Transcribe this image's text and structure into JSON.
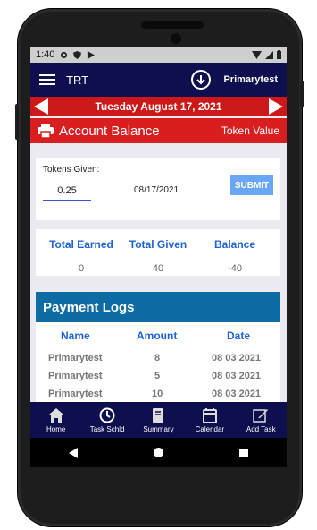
{
  "status": {
    "time": "1:40"
  },
  "appbar": {
    "title": "TRT",
    "user": "Primarytest"
  },
  "datebar": {
    "date": "Tuesday August 17, 2021"
  },
  "titlebar": {
    "title": "Account Balance",
    "right_label": "Token Value"
  },
  "form": {
    "tokens_label": "Tokens Given:",
    "tokens_value": "0.25",
    "date": "08/17/2021",
    "submit_label": "SUBMIT"
  },
  "totals": {
    "earned_label": "Total Earned",
    "earned_value": "0",
    "given_label": "Total Given",
    "given_value": "40",
    "balance_label": "Balance",
    "balance_value": "-40"
  },
  "logs": {
    "title": "Payment Logs",
    "columns": [
      "Name",
      "Amount",
      "Date"
    ],
    "rows": [
      {
        "name": "Primarytest",
        "amount": "8",
        "date": "08 03 2021"
      },
      {
        "name": "Primarytest",
        "amount": "5",
        "date": "08 03 2021"
      },
      {
        "name": "Primarytest",
        "amount": "10",
        "date": "08 03 2021"
      }
    ]
  },
  "bottom_nav": [
    {
      "label": "Home",
      "icon": "home-icon"
    },
    {
      "label": "Task Schld",
      "icon": "clock-icon"
    },
    {
      "label": "Summary",
      "icon": "book-icon"
    },
    {
      "label": "Calendar",
      "icon": "calendar-icon"
    },
    {
      "label": "Add Task",
      "icon": "edit-icon"
    }
  ],
  "colors": {
    "appbar": "#0d0f4f",
    "datebar": "#cc1818",
    "titlebar": "#d81e1e",
    "accent": "#1d63d6",
    "logs_header": "#0e6ba3",
    "submit": "#69a6f3"
  }
}
